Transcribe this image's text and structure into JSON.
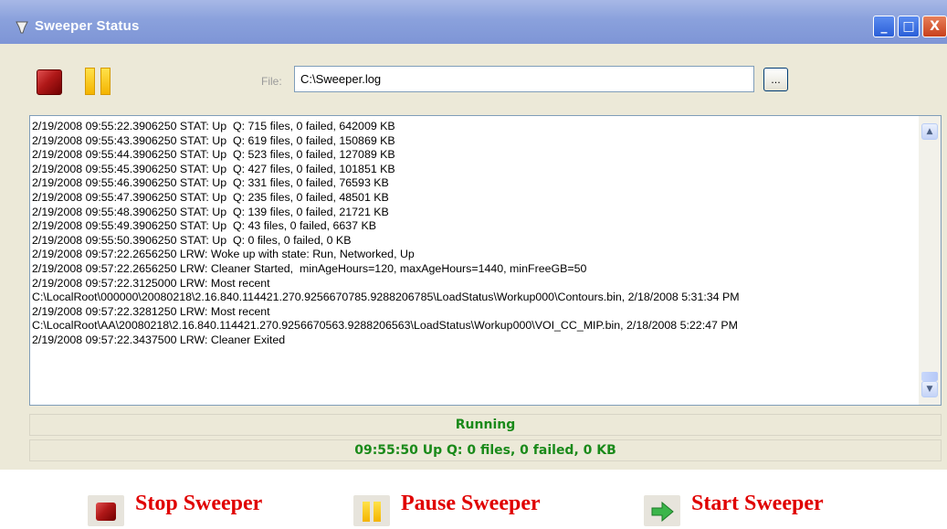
{
  "window": {
    "title": "Sweeper Status",
    "titlebar_buttons": {
      "minimize": "_",
      "maximize": "□",
      "close": "X"
    }
  },
  "toolbar": {
    "stop_icon": "stop-icon",
    "pause_icon": "pause-icon",
    "file_label": "File:",
    "file_value": "C:\\Sweeper.log",
    "browse_label": "..."
  },
  "log": {
    "lines": [
      "2/19/2008 09:55:22.3906250 STAT: Up  Q: 715 files, 0 failed, 642009 KB",
      "2/19/2008 09:55:43.3906250 STAT: Up  Q: 619 files, 0 failed, 150869 KB",
      "2/19/2008 09:55:44.3906250 STAT: Up  Q: 523 files, 0 failed, 127089 KB",
      "2/19/2008 09:55:45.3906250 STAT: Up  Q: 427 files, 0 failed, 101851 KB",
      "2/19/2008 09:55:46.3906250 STAT: Up  Q: 331 files, 0 failed, 76593 KB",
      "2/19/2008 09:55:47.3906250 STAT: Up  Q: 235 files, 0 failed, 48501 KB",
      "2/19/2008 09:55:48.3906250 STAT: Up  Q: 139 files, 0 failed, 21721 KB",
      "2/19/2008 09:55:49.3906250 STAT: Up  Q: 43 files, 0 failed, 6637 KB",
      "2/19/2008 09:55:50.3906250 STAT: Up  Q: 0 files, 0 failed, 0 KB",
      "2/19/2008 09:57:22.2656250 LRW: Woke up with state: Run, Networked, Up",
      "2/19/2008 09:57:22.2656250 LRW: Cleaner Started,  minAgeHours=120, maxAgeHours=1440, minFreeGB=50",
      "2/19/2008 09:57:22.3125000 LRW: Most recent",
      "C:\\LocalRoot\\000000\\20080218\\2.16.840.114421.270.9256670785.9288206785\\LoadStatus\\Workup000\\Contours.bin, 2/18/2008 5:31:34 PM",
      "2/19/2008 09:57:22.3281250 LRW: Most recent",
      "C:\\LocalRoot\\AA\\20080218\\2.16.840.114421.270.9256670563.9288206563\\LoadStatus\\Workup000\\VOI_CC_MIP.bin, 2/18/2008 5:22:47 PM",
      "2/19/2008 09:57:22.3437500 LRW: Cleaner Exited"
    ]
  },
  "status": {
    "state": "Running",
    "summary": "09:55:50   Up  Q: 0 files, 0 failed, 0 KB",
    "color": "#1a8a1a"
  },
  "legend": {
    "items": [
      {
        "icon": "stop-icon",
        "label": "Stop Sweeper"
      },
      {
        "icon": "pause-icon",
        "label": "Pause Sweeper"
      },
      {
        "icon": "arrow-right-icon",
        "label": "Start Sweeper"
      }
    ],
    "label_color": "#e00000"
  }
}
